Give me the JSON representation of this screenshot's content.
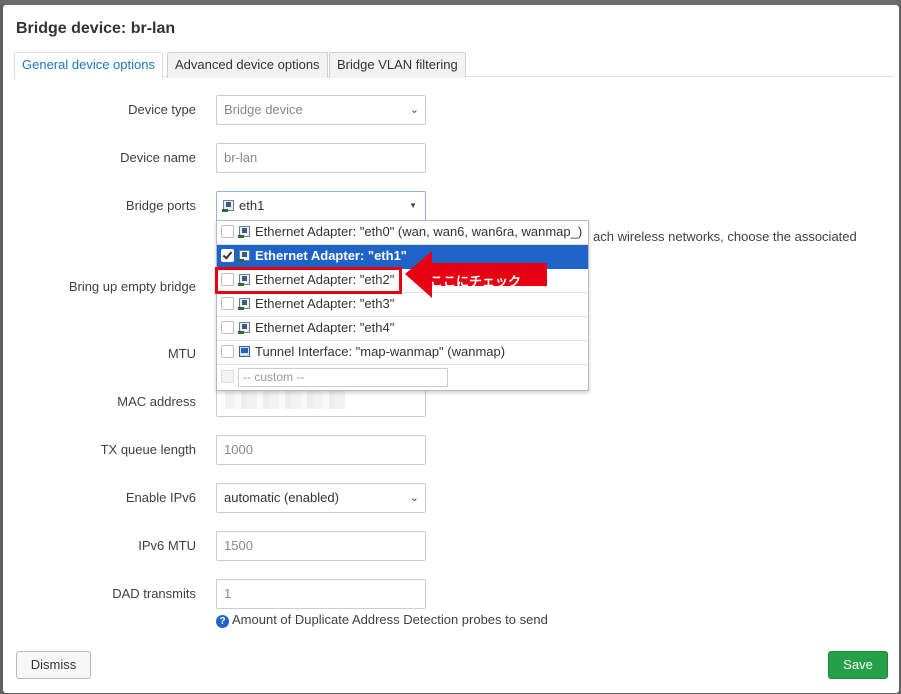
{
  "dialog": {
    "title": "Bridge device: br-lan"
  },
  "tabs": [
    {
      "label": "General device options",
      "active": true
    },
    {
      "label": "Advanced device options",
      "active": false
    },
    {
      "label": "Bridge VLAN filtering",
      "active": false
    }
  ],
  "form": {
    "device_type": {
      "label": "Device type",
      "value": "Bridge device"
    },
    "device_name": {
      "label": "Device name",
      "value": "br-lan"
    },
    "bridge_ports": {
      "label": "Bridge ports",
      "value": "eth1",
      "hint_fragment": "ach wireless networks, choose the associated",
      "options": [
        {
          "label": "Ethernet Adapter: \"eth0\" (wan, wan6, wan6ra, wanmap_)",
          "checked": false,
          "icon": "ethernet-icon"
        },
        {
          "label": "Ethernet Adapter: \"eth1\"",
          "checked": true,
          "icon": "ethernet-icon"
        },
        {
          "label": "Ethernet Adapter: \"eth2\"",
          "checked": false,
          "icon": "ethernet-icon"
        },
        {
          "label": "Ethernet Adapter: \"eth3\"",
          "checked": false,
          "icon": "ethernet-icon"
        },
        {
          "label": "Ethernet Adapter: \"eth4\"",
          "checked": false,
          "icon": "ethernet-icon"
        },
        {
          "label": "Tunnel Interface: \"map-wanmap\" (wanmap)",
          "checked": false,
          "icon": "tunnel-icon"
        }
      ],
      "custom_placeholder": "-- custom --"
    },
    "bring_up_empty": {
      "label": "Bring up empty bridge"
    },
    "mtu": {
      "label": "MTU"
    },
    "mac_address": {
      "label": "MAC address"
    },
    "tx_queue": {
      "label": "TX queue length",
      "placeholder": "1000"
    },
    "enable_ipv6": {
      "label": "Enable IPv6",
      "value": "automatic (enabled)"
    },
    "ipv6_mtu": {
      "label": "IPv6 MTU",
      "placeholder": "1500"
    },
    "dad_transmits": {
      "label": "DAD transmits",
      "placeholder": "1",
      "help": "Amount of Duplicate Address Detection probes to send"
    }
  },
  "annotation": {
    "text": "ここにチェック",
    "color": "#e60012"
  },
  "buttons": {
    "dismiss": "Dismiss",
    "save": "Save"
  },
  "colors": {
    "accent": "#1e64c8",
    "save": "#24a148",
    "annotation": "#e60012"
  }
}
